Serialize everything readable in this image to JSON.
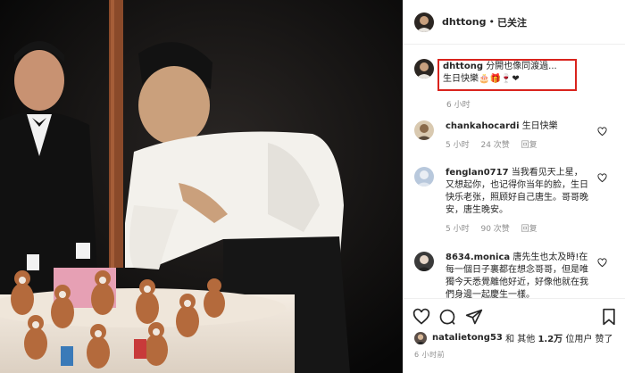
{
  "header": {
    "username": "dhttong",
    "separator": "•",
    "follow_status": "已关注"
  },
  "caption": {
    "username": "dhttong",
    "line1": "分開也像同渡過...",
    "line2": "生日快樂🎂🎁🍷❤",
    "time": "6 小时"
  },
  "comments": [
    {
      "username": "chankahocardi",
      "text": "生日快樂",
      "time": "5 小时",
      "likes": "24 次赞",
      "reply": "回复"
    },
    {
      "username": "fenglan0717",
      "text": "当我看见天上星，又想起你，也记得你当年的脸，生日快乐老张，照顾好自己唐生。哥哥晚安，唐生晚安。",
      "time": "5 小时",
      "likes": "90 次赞",
      "reply": "回复"
    },
    {
      "username": "8634.monica",
      "text": "唐先生也太及時!在每一個日子裏都在想念哥哥，但是唯獨今天悉覺離他好近，好像他就在我們身邊一起慶生一樣。"
    }
  ],
  "actions": {
    "liker": "natalietong53",
    "likes_prefix": "和 其他",
    "likes_count": "1.2万",
    "likes_suffix": "位用户 赞了",
    "post_time": "6 小时前"
  },
  "colors": {
    "highlight_border": "#d9231d",
    "meta_text": "#8e8e8e"
  }
}
